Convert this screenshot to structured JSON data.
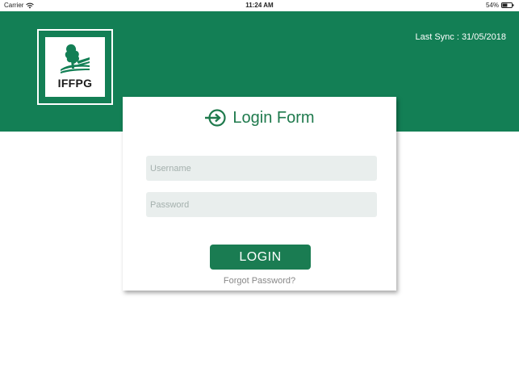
{
  "status_bar": {
    "carrier": "Carrier",
    "time": "11:24 AM",
    "battery_percent": "54%",
    "battery_level": 0.54,
    "wifi_icon": "wifi-icon",
    "battery_icon": "battery-icon"
  },
  "header": {
    "logo_text": "IFFPG",
    "last_sync": "Last Sync : 31/05/2018",
    "background_color": "#137f55"
  },
  "login_form": {
    "title": "Login Form",
    "title_icon": "login-icon",
    "username_placeholder": "Username",
    "password_placeholder": "Password",
    "login_label": "LOGIN",
    "forgot_label": "Forgot Password?",
    "accent_color": "#1a7c52"
  }
}
